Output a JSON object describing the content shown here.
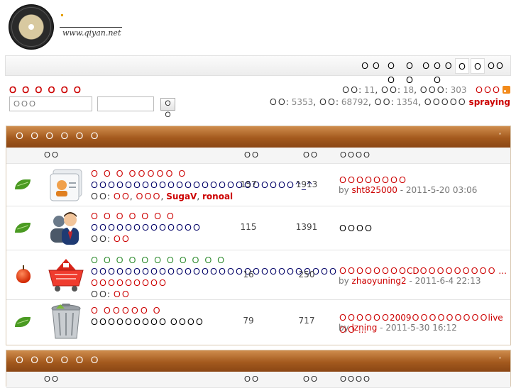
{
  "site": {
    "logo_text": "www.qiyan.net"
  },
  "nav": {
    "items": [
      "Ｏ Ｏ",
      "ＯＯ",
      "ＯＯ",
      "Ｏ Ｏ Ｏ Ｏ",
      "Ｏ",
      "Ｏ",
      "ＯＯ"
    ]
  },
  "user": {
    "title": "Ｏ Ｏ Ｏ Ｏ Ｏ Ｏ",
    "username_placeholder": "ＯＯＯ",
    "password_value": "",
    "login_button": "ＯＯ"
  },
  "stats": {
    "today_label": "ＯＯ:",
    "today": "11",
    "yesterday_label": "ＯＯ:",
    "yesterday": "18",
    "max_label": "ＯＯＯ:",
    "max": "303",
    "help_label": "ＯＯＯ",
    "topics_label": "ＯＯ:",
    "topics": "5353",
    "posts_label": "ＯＯ:",
    "posts": "68792",
    "members_label": "ＯＯ:",
    "members": "1354",
    "newest_label": "ＯＯＯＯＯ",
    "newest": "spraying",
    "rss_icon": "rss-icon"
  },
  "sections": [
    {
      "title": "Ｏ Ｏ Ｏ Ｏ Ｏ Ｏ",
      "collapse": "˄",
      "col_forum": "ＯＯ",
      "col_topics": "ＯＯ",
      "col_posts": "ＯＯ",
      "col_last": "ＯＯＯＯ",
      "forums": [
        {
          "status_icon": "leaf-icon",
          "icon": "contacts-card-icon",
          "title": "Ｏ Ｏ Ｏ ＯＯＯＯＯ Ｏ",
          "desc": "ＯＯＯＯＯＯＯＯＯＯＯＯＯＯＯＯＯＯＯＯＯＯＯＯ^_^",
          "mods_label": "ＯＯ:",
          "mods": [
            "ＯＯ",
            "ＯＯＯ",
            "SugaV",
            "ronoal"
          ],
          "topics": "157",
          "posts": "1913",
          "last_title": "ＯＯＯＯＯＯＯＯ",
          "last_by_label": "by",
          "last_user": "sht825000",
          "last_time": "- 2011-5-20 03:06"
        },
        {
          "status_icon": "leaf-icon",
          "icon": "users-group-icon",
          "title": "Ｏ Ｏ Ｏ Ｏ Ｏ Ｏ Ｏ",
          "desc": "ＯＯＯＯＯＯＯＯＯＯＯＯＯ",
          "mods_label": "ＯＯ:",
          "mods": [
            "ＯＯ"
          ],
          "topics": "115",
          "posts": "1391",
          "last_plain": "ＯＯＯＯ"
        },
        {
          "status_icon": "apple-icon",
          "icon": "shopping-basket-icon",
          "title": "Ｏ Ｏ Ｏ Ｏ Ｏ Ｏ Ｏ Ｏ Ｏ Ｏ Ｏ",
          "desc": "ＯＯＯＯＯＯＯＯＯＯＯＯＯＯＯＯＯＯＯＯＯＯＯＯＯＯＯＯＯ",
          "desc2": "ＯＯＯＯＯＯＯＯＯ",
          "mods_label": "ＯＯ:",
          "mods": [
            "ＯＯ"
          ],
          "topics": "16",
          "posts": "250",
          "last_title": "ＯＯＯＯＯＯＯＯCDＯＯＯＯＯＯＯＯＯ ...",
          "last_by_label": "by",
          "last_user": "zhaoyuning2",
          "last_time": "- 2011-6-4 22:13"
        },
        {
          "status_icon": "leaf-icon",
          "icon": "trash-bin-icon",
          "title": "Ｏ ＯＯＯＯＯ Ｏ",
          "desc": "ＯＯＯＯＯＯＯＯＯ ＯＯＯＯ",
          "mods_label": "",
          "mods": [],
          "topics": "79",
          "posts": "717",
          "last_title": "ＯＯＯＯＯＯ2009ＯＯＯＯＯＯＯＯＯliveＯＯ ...",
          "last_by_label": "by",
          "last_user": "lzning",
          "last_time": "- 2011-5-30 16:12"
        }
      ]
    },
    {
      "title": "Ｏ Ｏ Ｏ Ｏ Ｏ Ｏ",
      "collapse": "˄",
      "col_forum": "ＯＯ",
      "col_topics": "ＯＯ",
      "col_posts": "ＯＯ",
      "col_last": "ＯＯＯＯ"
    }
  ]
}
